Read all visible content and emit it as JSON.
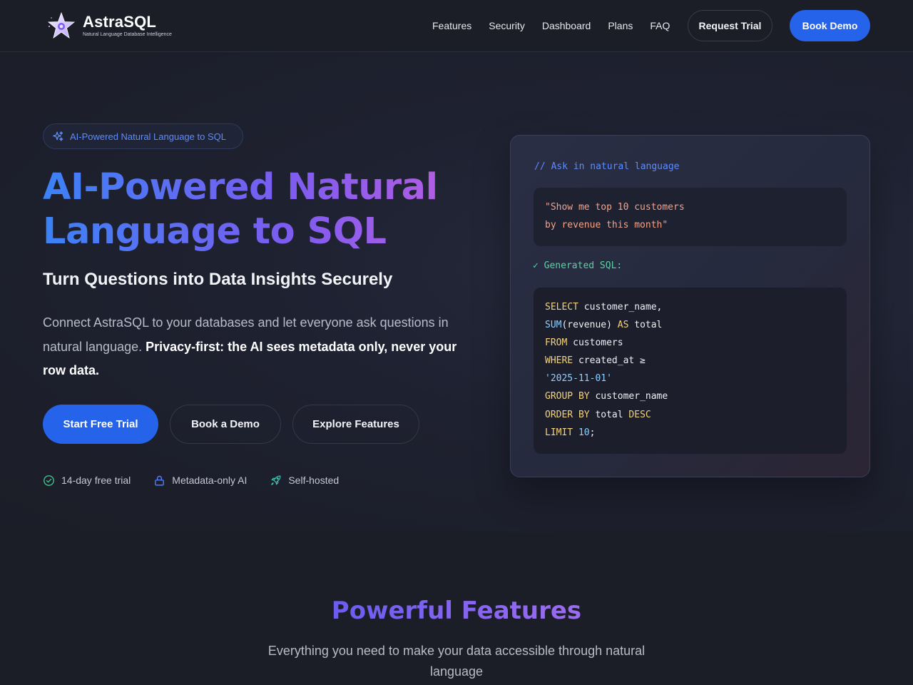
{
  "brand": {
    "name": "AstraSQL",
    "tagline": "Natural Language Database Intelligence",
    "logo_icon": "star-logo-icon"
  },
  "nav": {
    "links": [
      "Features",
      "Security",
      "Dashboard",
      "Plans",
      "FAQ"
    ],
    "request_trial": "Request Trial",
    "book_demo": "Book Demo"
  },
  "hero": {
    "badge": "AI-Powered Natural Language to SQL",
    "title_line1": "AI-Powered Natural",
    "title_line2": "Language to SQL",
    "subtitle": "Turn Questions into Data Insights Securely",
    "desc_plain": "Connect AstraSQL to your databases and let everyone ask questions in natural language. ",
    "desc_bold": "Privacy-first: the AI sees metadata only, never your row data.",
    "cta_primary": "Start Free Trial",
    "cta_secondary": "Book a Demo",
    "cta_tertiary": "Explore Features",
    "trust": [
      {
        "label": "14-day free trial",
        "icon": "check-circle-icon"
      },
      {
        "label": "Metadata-only AI",
        "icon": "lock-icon"
      },
      {
        "label": "Self-hosted",
        "icon": "rocket-icon"
      }
    ]
  },
  "code_card": {
    "comment": "// Ask in natural language",
    "prompt_line1": "\"Show me top 10 customers",
    "prompt_line2": "by revenue this month\"",
    "generated_label": "✓ Generated SQL:",
    "sql": {
      "l1_kw": "SELECT",
      "l1_rest": " customer_name,",
      "l2_fn": "SUM",
      "l2_mid": "(revenue) ",
      "l2_kw": "AS",
      "l2_rest": " total",
      "l3_kw": "FROM",
      "l3_rest": " customers",
      "l4_kw": "WHERE",
      "l4_rest": " created_at ≥",
      "l5_str": "'2025-11-01'",
      "l6_kw": "GROUP BY",
      "l6_rest": " customer_name",
      "l7_kw": "ORDER BY",
      "l7_mid": " total ",
      "l7_kw2": "DESC",
      "l8_kw": "LIMIT",
      "l8_sp": " ",
      "l8_num": "10",
      "l8_end": ";"
    }
  },
  "features": {
    "title": "Powerful Features",
    "subtitle": "Everything you need to make your data accessible through natural language"
  },
  "colors": {
    "accent": "#2563eb",
    "background": "#1b1d27",
    "keyword": "#f5d37a",
    "prompt": "#f3a38a",
    "success": "#5ed0a4"
  }
}
